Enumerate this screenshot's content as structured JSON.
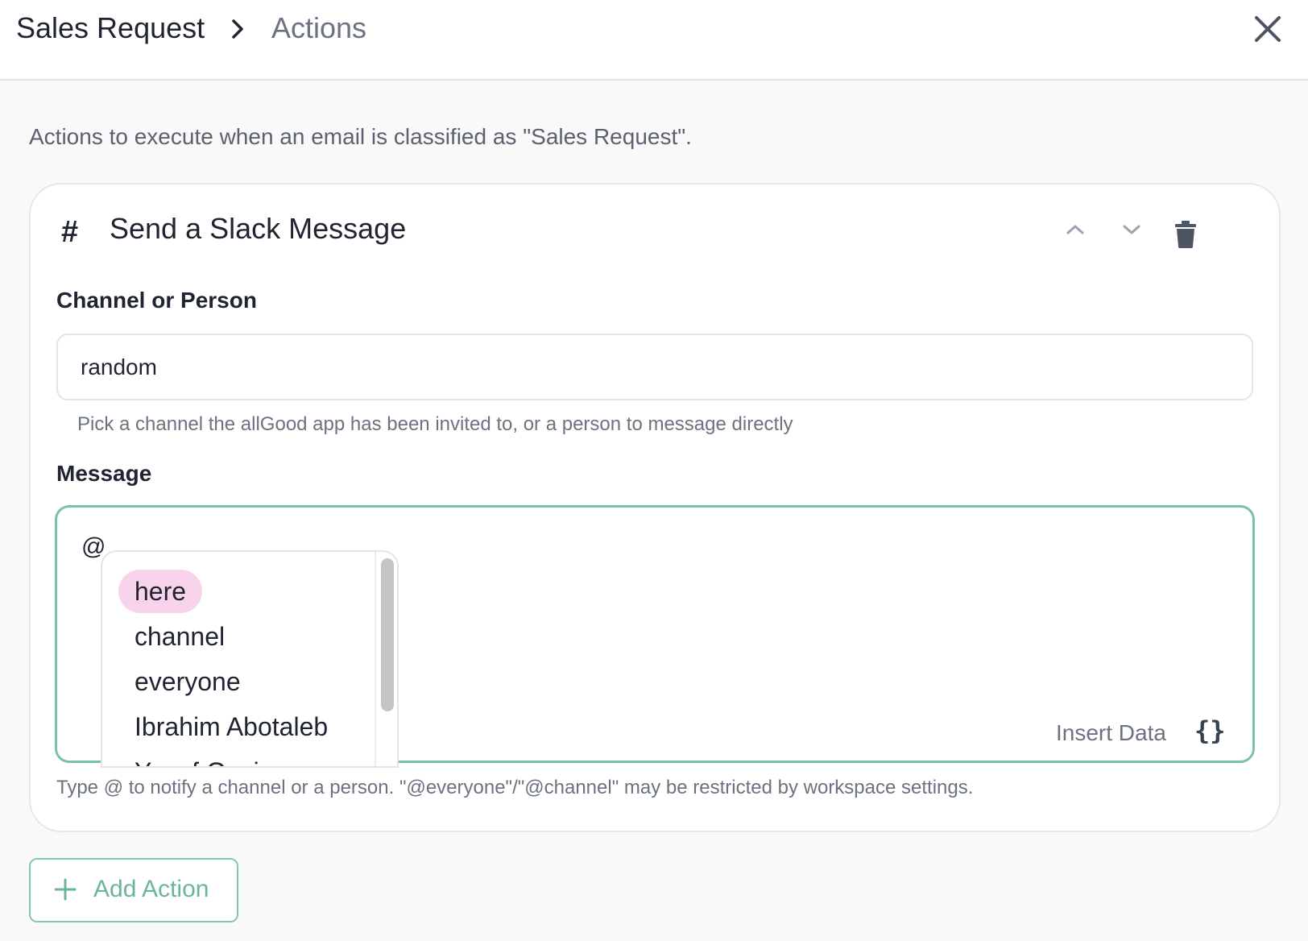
{
  "header": {
    "breadcrumb_root": "Sales Request",
    "breadcrumb_current": "Actions",
    "separator_icon": "chevron-right-icon",
    "close_icon": "close-icon"
  },
  "intro_text": "Actions to execute when an email is classified as \"Sales Request\".",
  "action_card": {
    "icon_text": "#",
    "title": "Send a Slack Message",
    "controls": [
      "chevron-up-icon",
      "chevron-down-icon",
      "trash-icon"
    ],
    "channel_field": {
      "label": "Channel or Person",
      "value": "random",
      "helper": "Pick a channel the allGood app has been invited to, or a person to message directly"
    },
    "message_field": {
      "label": "Message",
      "value": "@",
      "insert_data_label": "Insert Data",
      "insert_data_icon_text": "{}",
      "helper": "Type @ to notify a channel or a person. \"@everyone\"/\"@channel\" may be restricted by workspace settings."
    }
  },
  "mention_dropdown": {
    "items": [
      "here",
      "channel",
      "everyone",
      "Ibrahim Abotaleb",
      "Yusef Gazi"
    ],
    "active_index": 0
  },
  "add_action": {
    "label": "Add Action"
  },
  "colors": {
    "accent_green": "#79c3a2",
    "mention_highlight": "#f7d4ec"
  }
}
